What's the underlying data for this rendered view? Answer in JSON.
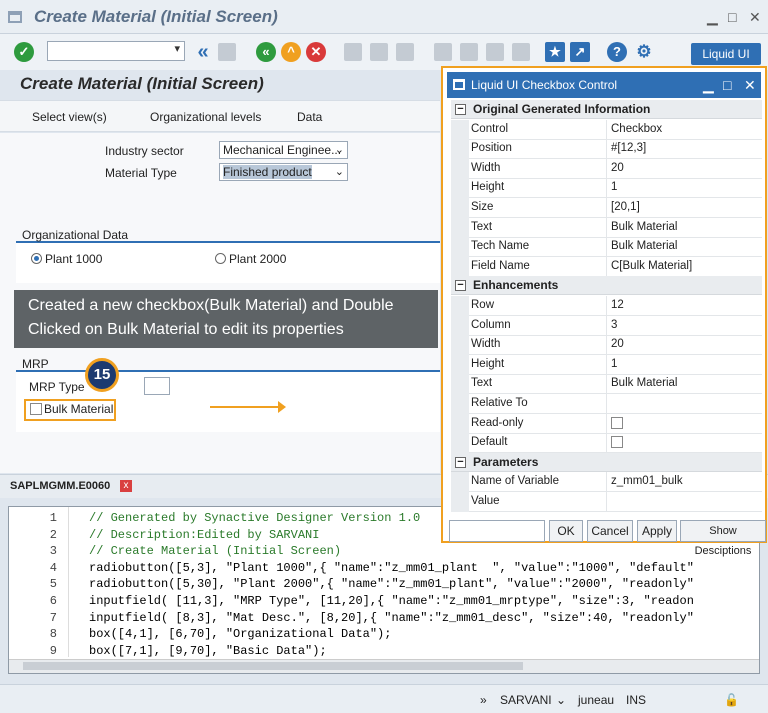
{
  "window": {
    "title": "Create Material (Initial Screen)"
  },
  "toolbar": {
    "liquid_ui_label": "Liquid UI"
  },
  "screen": {
    "title": "Create Material (Initial Screen)"
  },
  "menu": {
    "items": [
      "Select view(s)",
      "Organizational levels",
      "Data"
    ]
  },
  "fields": {
    "industry_sector_label": "Industry sector",
    "industry_sector_value": "Mechanical Enginee...",
    "material_type_label": "Material Type",
    "material_type_value": "Finished product"
  },
  "org_data": {
    "title": "Organizational Data",
    "plant1": "Plant 1000",
    "plant2": "Plant 2000"
  },
  "mrp": {
    "title": "MRP",
    "type_label": "MRP Type",
    "checkbox_label": "Bulk Material"
  },
  "callout": {
    "text_line1": "Created a new checkbox(Bulk Material) and Double",
    "text_line2": "Clicked on Bulk Material to edit its properties",
    "step": "15"
  },
  "editor": {
    "tab": "SAPLMGMM.E0060",
    "lines": [
      {
        "n": "1",
        "t": "// Generated by Synactive Designer Version 1.0",
        "c": true
      },
      {
        "n": "2",
        "t": "// Description:Edited by SARVANI",
        "c": true
      },
      {
        "n": "3",
        "t": "// Create Material (Initial Screen)",
        "c": true
      },
      {
        "n": "4",
        "t": "radiobutton([5,3], \"Plant 1000\",{ \"name\":\"z_mm01_plant  \", \"value\":\"1000\", \"default\"",
        "c": false
      },
      {
        "n": "5",
        "t": "radiobutton([5,30], \"Plant 2000\",{ \"name\":\"z_mm01_plant\", \"value\":\"2000\", \"readonly\"",
        "c": false
      },
      {
        "n": "6",
        "t": "inputfield( [11,3], \"MRP Type\", [11,20],{ \"name\":\"z_mm01_mrptype\", \"size\":3, \"readon",
        "c": false
      },
      {
        "n": "7",
        "t": "inputfield( [8,3], \"Mat Desc.\", [8,20],{ \"name\":\"z_mm01_desc\", \"size\":40, \"readonly\"",
        "c": false
      },
      {
        "n": "8",
        "t": "box([4,1], [6,70], \"Organizational Data\");",
        "c": false
      },
      {
        "n": "9",
        "t": "box([7,1], [9,70], \"Basic Data\");",
        "c": false
      }
    ]
  },
  "status": {
    "user": "SARVANI",
    "host": "juneau",
    "mode": "INS"
  },
  "dialog": {
    "title": "Liquid UI Checkbox Control",
    "sections": [
      {
        "title": "Original Generated Information",
        "rows": [
          {
            "k": "Control",
            "v": "Checkbox"
          },
          {
            "k": "Position",
            "v": "#[12,3]"
          },
          {
            "k": "Width",
            "v": "20"
          },
          {
            "k": "Height",
            "v": "1"
          },
          {
            "k": "Size",
            "v": "[20,1]"
          },
          {
            "k": "Text",
            "v": "Bulk Material"
          },
          {
            "k": "Tech Name",
            "v": "Bulk Material"
          },
          {
            "k": "Field Name",
            "v": "C[Bulk Material]"
          }
        ]
      },
      {
        "title": "Enhancements",
        "rows": [
          {
            "k": "Row",
            "v": "12"
          },
          {
            "k": "Column",
            "v": "3"
          },
          {
            "k": "Width",
            "v": "20"
          },
          {
            "k": "Height",
            "v": "1"
          },
          {
            "k": "Text",
            "v": "Bulk Material"
          },
          {
            "k": "Relative To",
            "v": ""
          },
          {
            "k": "Read-only",
            "v": "",
            "checkbox": true
          },
          {
            "k": "Default",
            "v": "",
            "checkbox": true
          }
        ]
      },
      {
        "title": "Parameters",
        "rows": [
          {
            "k": "Name of Variable",
            "v": "z_mm01_bulk"
          },
          {
            "k": "Value",
            "v": ""
          }
        ]
      }
    ],
    "buttons": [
      "OK",
      "Cancel",
      "Apply",
      "Show Desciptions"
    ]
  }
}
